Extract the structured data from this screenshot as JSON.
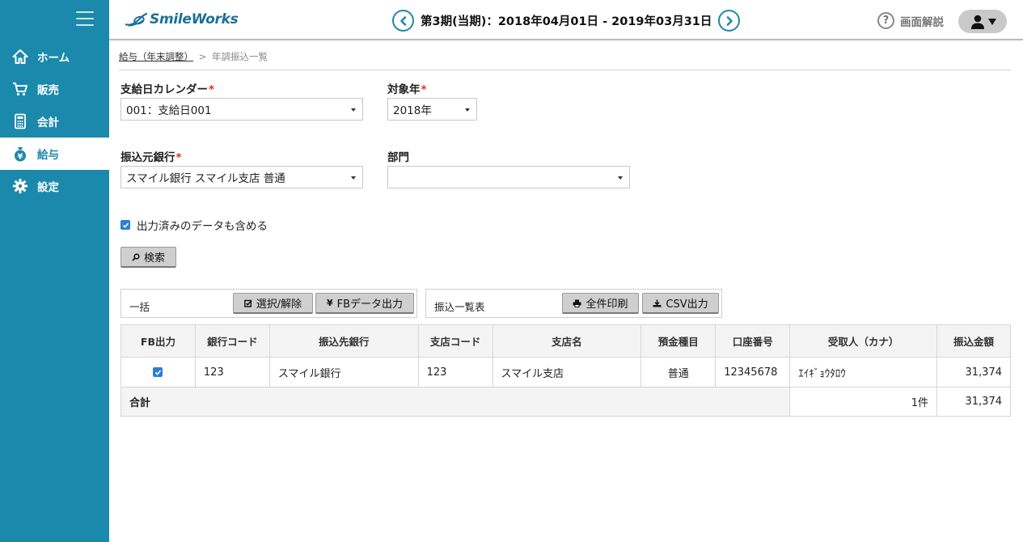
{
  "app": {
    "logo_text": "SmileWorks"
  },
  "header": {
    "period": "第3期(当期)：2018年04月01日 - 2019年03月31日",
    "help_label": "画面解説"
  },
  "sidebar": {
    "items": [
      {
        "label": "ホーム",
        "icon": "home-icon"
      },
      {
        "label": "販売",
        "icon": "cart-icon"
      },
      {
        "label": "会計",
        "icon": "calculator-icon"
      },
      {
        "label": "給与",
        "icon": "money-bag-icon",
        "active": true
      },
      {
        "label": "設定",
        "icon": "gear-icon"
      }
    ]
  },
  "breadcrumb": {
    "parent": "給与（年末調整）",
    "separator": ">",
    "current": "年調振込一覧"
  },
  "form": {
    "calendar": {
      "label": "支給日カレンダー",
      "value": "001：支給日001"
    },
    "year": {
      "label": "対象年",
      "value": "2018年"
    },
    "bank": {
      "label": "振込元銀行",
      "value": "スマイル銀行 スマイル支店 普通"
    },
    "department": {
      "label": "部門",
      "value": ""
    },
    "required_mark": "*",
    "include_output": {
      "label": "出力済みのデータも含める",
      "checked": true
    },
    "search_label": "検索"
  },
  "bulk_panel": {
    "label": "一括",
    "toggle_label": "選択/解除",
    "fb_label": "FBデータ出力"
  },
  "list_panel": {
    "label": "振込一覧表",
    "print_label": "全件印刷",
    "csv_label": "CSV出力"
  },
  "table": {
    "headers": [
      "FB出力",
      "銀行コード",
      "振込先銀行",
      "支店コード",
      "支店名",
      "預金種目",
      "口座番号",
      "受取人（カナ）",
      "振込金額"
    ],
    "rows": [
      {
        "fb": true,
        "bank_code": "123",
        "bank": "スマイル銀行",
        "branch_code": "123",
        "branch": "スマイル支店",
        "type": "普通",
        "account": "12345678",
        "payee": "ｴｲｷﾞｮｳﾀﾛｳ",
        "amount": "31,374"
      }
    ],
    "total": {
      "label": "合計",
      "count": "1件",
      "amount": "31,374"
    }
  },
  "colors": {
    "sidebar": "#1b89ab",
    "accent": "#1b89ab",
    "required": "#d9302b",
    "checkbox": "#2b7fd8"
  }
}
